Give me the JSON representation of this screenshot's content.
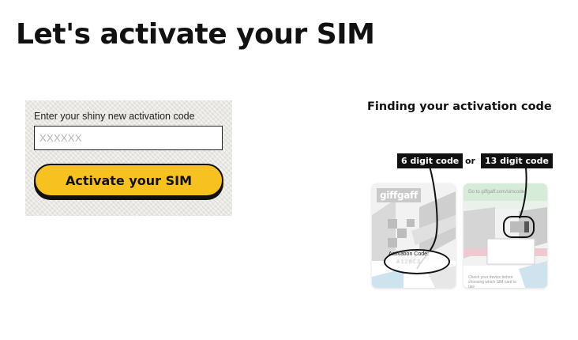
{
  "page": {
    "title": "Let's activate your SIM"
  },
  "activation_form": {
    "label": "Enter your shiny new activation code",
    "input_value": "",
    "input_placeholder": "XXXXXX",
    "button_label": "Activate your SIM"
  },
  "help": {
    "title": "Finding your activation code",
    "six_digit_tag": "6 digit code",
    "or_text": "or",
    "thirteen_digit_tag": "13 digit code",
    "left_card": {
      "brand": "giffgaff",
      "activation_label": "Activation Code:",
      "activation_value": "A12BC3"
    },
    "right_card": {
      "goto_text": "Go to giffgaff.com/simcode",
      "footer_text": "Check your device before choosing which SIM card to use"
    }
  },
  "colors": {
    "button_yellow": "#f7c21f",
    "panel_bg": "#e9e7e1",
    "text_dark": "#111111"
  }
}
